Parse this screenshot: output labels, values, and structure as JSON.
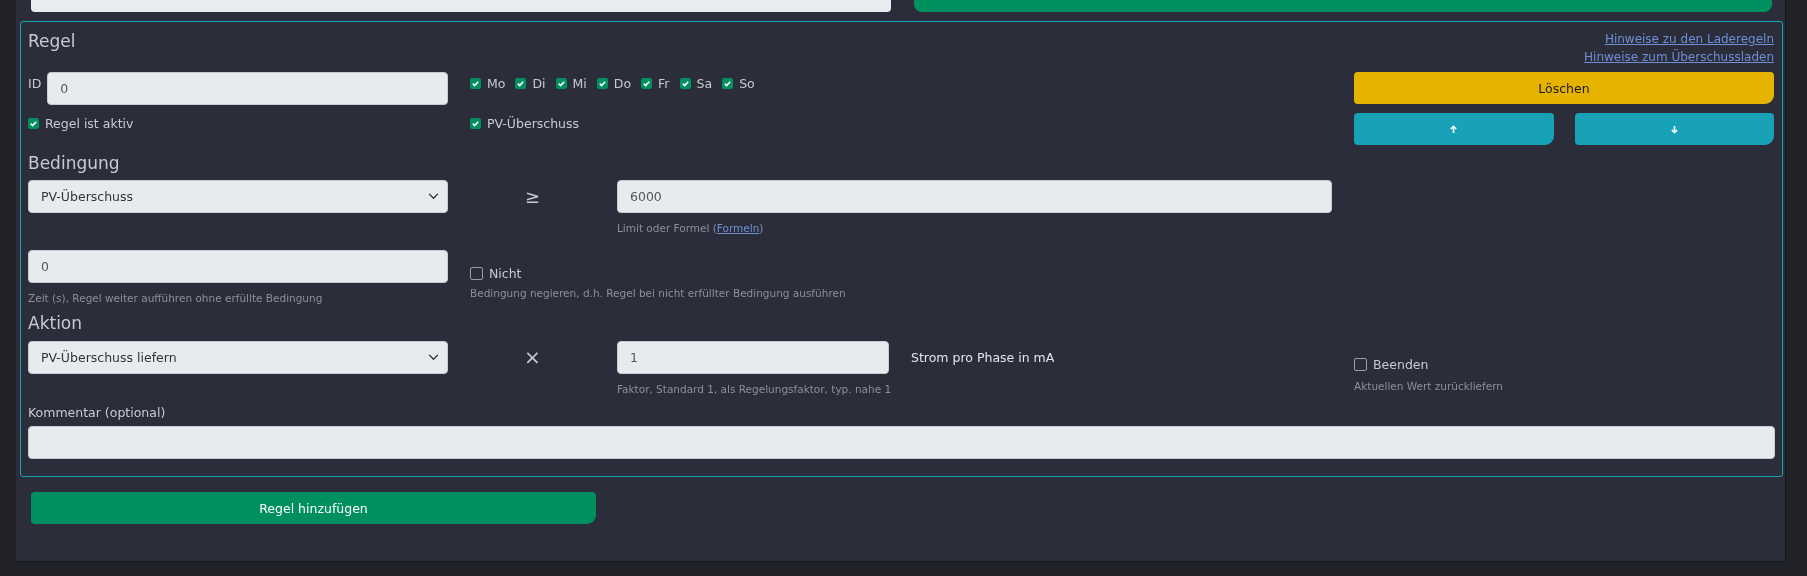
{
  "rule_panel": {
    "title": "Regel",
    "links": [
      "Hinweise zu den Laderegeln",
      "Hinweise zum Überschussladen"
    ],
    "id": {
      "label": "ID",
      "value": "0"
    },
    "weekdays": [
      {
        "label": "Mo",
        "checked": true
      },
      {
        "label": "Di",
        "checked": true
      },
      {
        "label": "Mi",
        "checked": true
      },
      {
        "label": "Do",
        "checked": true
      },
      {
        "label": "Fr",
        "checked": true
      },
      {
        "label": "Sa",
        "checked": true
      },
      {
        "label": "So",
        "checked": true
      }
    ],
    "active": {
      "label": "Regel ist aktiv",
      "checked": true
    },
    "pv_surplus": {
      "label": "PV-Überschuss",
      "checked": true
    },
    "delete_button": "Löschen",
    "condition": {
      "title": "Bedingung",
      "select": "PV-Überschuss",
      "operator": "≥",
      "limit": "6000",
      "limit_help_before": "Limit oder Formel (",
      "limit_help_link": "Formeln",
      "limit_help_after": ")"
    },
    "delay": {
      "value": "0",
      "help": "Zeit (s), Regel weiter aufführen ohne erfüllte Bedingung"
    },
    "negate": {
      "label": "Nicht",
      "checked": false,
      "help": "Bedingung negieren, d.h. Regel bei nicht erfüllter Bedingung ausführen"
    },
    "action": {
      "title": "Aktion",
      "select": "PV-Überschuss liefern",
      "operator": "×",
      "factor": "1",
      "factor_help": "Faktor, Standard 1, als Regelungsfaktor, typ. nahe 1",
      "unit": "Strom pro Phase in mA"
    },
    "finish": {
      "label": "Beenden",
      "checked": false,
      "help": "Aktuellen Wert zurückliefern"
    },
    "comment": {
      "label": "Kommentar (optional)"
    }
  },
  "add_button": "Regel hinzufügen"
}
